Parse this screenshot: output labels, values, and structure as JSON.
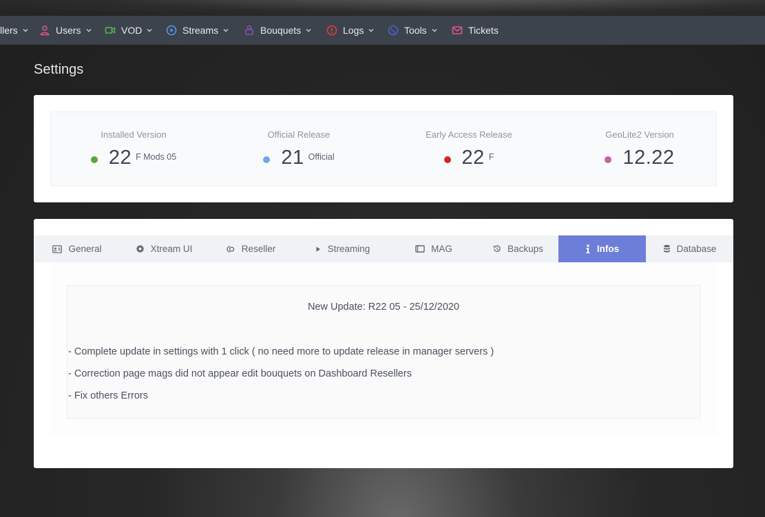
{
  "nav": {
    "items": [
      {
        "label": "llers",
        "icon": "chevron-down-icon"
      },
      {
        "label": "Users",
        "icon": "user-icon"
      },
      {
        "label": "VOD",
        "icon": "video-icon"
      },
      {
        "label": "Streams",
        "icon": "play-circle-icon"
      },
      {
        "label": "Bouquets",
        "icon": "gift-icon"
      },
      {
        "label": "Logs",
        "icon": "alert-circle-icon"
      },
      {
        "label": "Tools",
        "icon": "globe-icon"
      },
      {
        "label": "Tickets",
        "icon": "mail-icon"
      }
    ],
    "colors": {
      "users": "#e0558f",
      "vod": "#52b94a",
      "streams": "#4d9be8",
      "bouquets": "#8a4fc2",
      "logs": "#e23b3b",
      "tools": "#4a5fd6",
      "tickets": "#e0558f"
    }
  },
  "page": {
    "title": "Settings"
  },
  "versions": [
    {
      "label": "Installed Version",
      "value": "22",
      "suffix": "F Mods 05",
      "dot_color": "#58aa34"
    },
    {
      "label": "Official Release",
      "value": "21",
      "suffix": "Official",
      "dot_color": "#6fa9e6"
    },
    {
      "label": "Early Access Release",
      "value": "22",
      "suffix": "F",
      "dot_color": "#d3262a"
    },
    {
      "label": "GeoLite2 Version",
      "value": "12.22",
      "suffix": "",
      "dot_color": "#c95fa6"
    }
  ],
  "tabs": [
    {
      "label": "General",
      "icon": "id-card-icon",
      "active": false
    },
    {
      "label": "Xtream UI",
      "icon": "gear-icon",
      "active": false
    },
    {
      "label": "Reseller",
      "icon": "reseller-icon",
      "active": false
    },
    {
      "label": "Streaming",
      "icon": "play-icon",
      "active": false
    },
    {
      "label": "MAG",
      "icon": "tablet-icon",
      "active": false
    },
    {
      "label": "Backups",
      "icon": "history-icon",
      "active": false
    },
    {
      "label": "Infos",
      "icon": "info-icon",
      "active": true
    },
    {
      "label": "Database",
      "icon": "database-icon",
      "active": false
    }
  ],
  "infos": {
    "title": "New Update: R22 05 - 25/12/2020",
    "lines": [
      "- Complete update in settings with 1 click ( no need more to update release in manager servers )",
      "- Correction page mags did not appear edit bouquets on Dashboard Resellers",
      "- Fix others Errors"
    ]
  },
  "theme": {
    "accent": "#6c7ed8",
    "navbar": "#3d434c"
  }
}
